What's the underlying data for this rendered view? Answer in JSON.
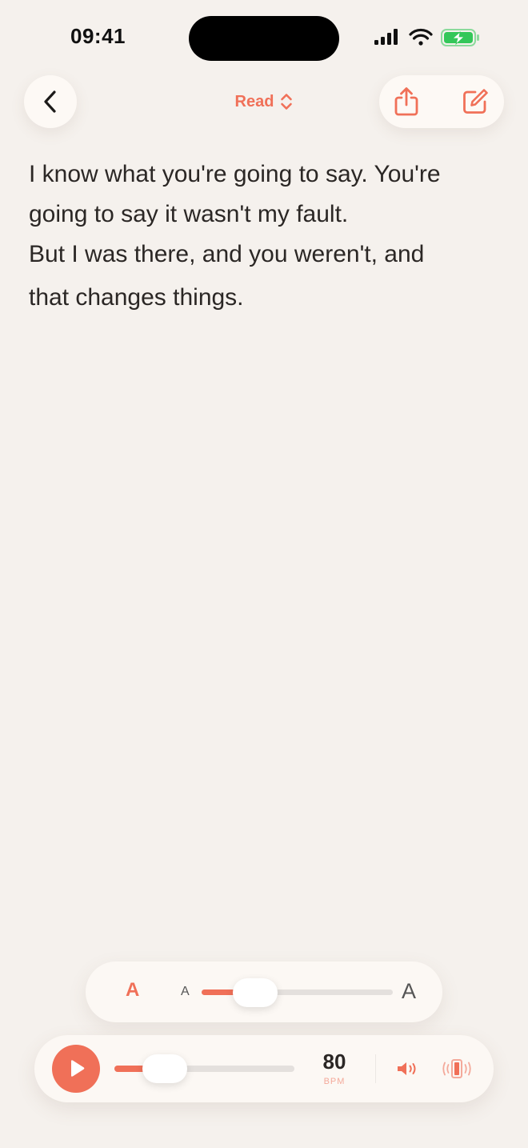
{
  "status_bar": {
    "time": "09:41"
  },
  "nav": {
    "mode_label": "Read",
    "back_icon": "chevron-left-icon",
    "mode_icon": "chevron-up-down-icon",
    "share_icon": "share-icon",
    "edit_icon": "edit-icon"
  },
  "reading": {
    "lines": [
      "I know what you're going to say. You're",
      "going to say it wasn't my fault.",
      "But I was there, and you weren't, and",
      "that changes things."
    ]
  },
  "font_panel": {
    "toggle_label": "A",
    "small_label": "A",
    "large_label": "A",
    "size_level": 0.28
  },
  "metronome": {
    "bpm_value": "80",
    "bpm_unit": "BPM",
    "tempo_level": 0.28,
    "play_icon": "play-icon",
    "sound_icon": "speaker-icon",
    "vibrate_icon": "vibrate-icon"
  },
  "colors": {
    "accent": "#f07058",
    "background": "#f5f1ed",
    "panel": "#fcf8f4",
    "text": "#2b2725",
    "track": "#e4e0dd",
    "battery": "#34c759"
  }
}
